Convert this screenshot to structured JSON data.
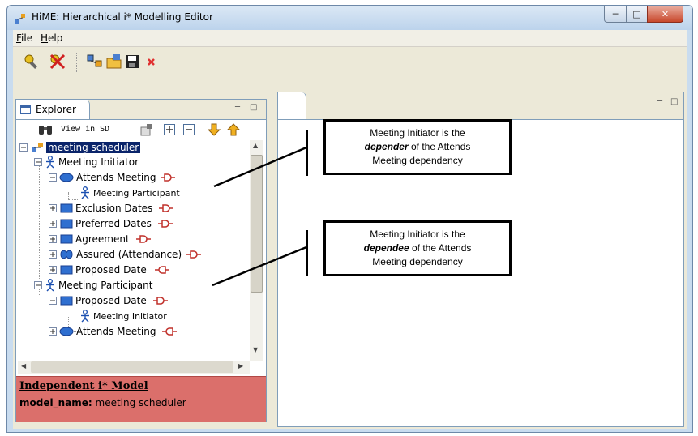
{
  "window": {
    "title": "HiME: Hierarchical i* Modelling Editor"
  },
  "menu": [
    {
      "label": "File"
    },
    {
      "label": "Help"
    }
  ],
  "explorer": {
    "tab_label": "Explorer",
    "view_in_sd_label": "View in SD",
    "tree": {
      "root": "meeting scheduler",
      "initiator": "Meeting Initiator",
      "attends_meeting": "Attends Meeting",
      "participant_child": "Meeting Participant",
      "exclusion_dates": "Exclusion Dates",
      "preferred_dates": "Preferred Dates",
      "agreement": "Agreement",
      "assured": "Assured (Attendance)",
      "proposed_date": "Proposed Date",
      "participant": "Meeting Participant",
      "proposed_date_2": "Proposed Date",
      "initiator_child": "Meeting Initiator",
      "attends_meeting_2": "Attends Meeting"
    }
  },
  "properties": {
    "title": "Independent i* Model",
    "key": "model_name:",
    "value": "meeting scheduler"
  },
  "callouts": {
    "depender": {
      "pre": "Meeting Initiator  is the",
      "em": "depender",
      "post": " of the Attends",
      "line3": "Meeting dependency"
    },
    "dependee": {
      "pre": "Meeting Initiator  is the",
      "em": "dependee",
      "post": " of the Attends",
      "line3": "Meeting dependency"
    }
  },
  "colors": {
    "selection": "#0a246a",
    "properties_bg": "#db6f6b",
    "goal_blue": "#2f6fd0",
    "dependency_red": "#c0302a"
  }
}
